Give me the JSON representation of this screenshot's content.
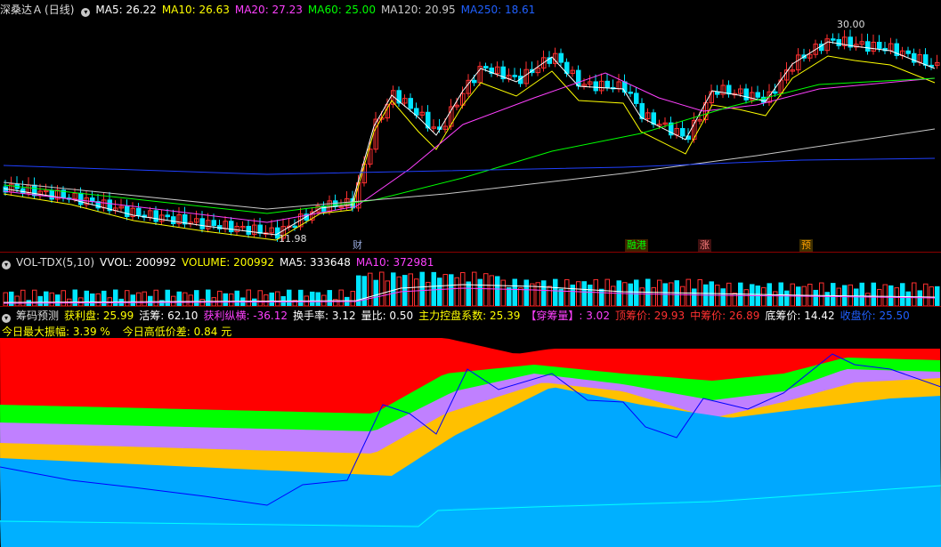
{
  "price_panel": {
    "stock_name": "深桑达Ａ",
    "period": "(日线)",
    "ma_labels": [
      {
        "text": "MA5: 26.22",
        "color": "#ffffff"
      },
      {
        "text": "MA10: 26.63",
        "color": "#ffff00"
      },
      {
        "text": "MA20: 27.23",
        "color": "#ff40ff"
      },
      {
        "text": "MA60: 25.00",
        "color": "#00ff00"
      },
      {
        "text": "MA120: 20.95",
        "color": "#c8c8c8"
      },
      {
        "text": "MA250: 18.61",
        "color": "#2060ff"
      }
    ],
    "high_label": "30.00",
    "low_label": "11.98",
    "events": [
      "财",
      "融港",
      "涨",
      "预"
    ]
  },
  "volume_panel": {
    "labels": [
      {
        "text": "VOL-TDX(5,10)",
        "color": "#dddddd"
      },
      {
        "text": "VVOL: 200992",
        "color": "#ffffff"
      },
      {
        "text": "VOLUME: 200992",
        "color": "#ffff00"
      },
      {
        "text": "MA5: 333648",
        "color": "#ffffff"
      },
      {
        "text": "MA10: 372981",
        "color": "#ff40ff"
      }
    ]
  },
  "chip_panel": {
    "title": "筹码预测",
    "labels": [
      {
        "text": "获利盘: 25.99",
        "color": "#ffff00"
      },
      {
        "text": "活筹: 62.10",
        "color": "#ffffff"
      },
      {
        "text": "获利纵横: -36.12",
        "color": "#ff40ff"
      },
      {
        "text": "换手率: 3.12",
        "color": "#ffffff"
      },
      {
        "text": "量比: 0.50",
        "color": "#ffffff"
      },
      {
        "text": "主力控盘系数: 25.39",
        "color": "#ffff00"
      },
      {
        "text": "【穿筹量】: 3.02",
        "color": "#ff40ff"
      },
      {
        "text": "顶筹价: 29.93",
        "color": "#ff3030"
      },
      {
        "text": "中筹价: 26.89",
        "color": "#ff3030"
      },
      {
        "text": "底筹价: 14.42",
        "color": "#ffffff"
      },
      {
        "text": "收盘价: 25.50",
        "color": "#2060ff"
      }
    ],
    "line2": [
      {
        "text": "今日最大振幅: 3.39 %",
        "color": "#ffff00"
      },
      {
        "text": "今日高低价差: 0.84 元",
        "color": "#ffff00"
      }
    ]
  },
  "colors": {
    "up": "#ff3030",
    "down": "#00e5ff",
    "bg": "#000000",
    "band_red": "#ff0000",
    "band_green": "#00ff00",
    "band_violet": "#c080ff",
    "band_yellow": "#ffc000",
    "band_blue": "#00a8ff",
    "close_line": "#0000ff",
    "cyan_line": "#00ffff"
  }
}
